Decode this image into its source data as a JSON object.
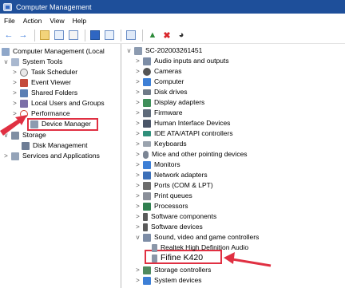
{
  "window": {
    "title": "Computer Management"
  },
  "menu": [
    "File",
    "Action",
    "View",
    "Help"
  ],
  "toolbar": {
    "icons": [
      "back-arrow-icon",
      "forward-arrow-icon",
      "up-folder-icon",
      "properties-icon",
      "console-icon",
      "help-icon",
      "show-hide-icon",
      "scan-hardware-icon",
      "update-driver-icon",
      "uninstall-icon",
      "download-icon"
    ]
  },
  "left_tree": [
    {
      "label": "Computer Management (Local",
      "toggle": "",
      "level": 0
    },
    {
      "label": "System Tools",
      "toggle": "v",
      "level": 1
    },
    {
      "label": "Task Scheduler",
      "toggle": ">",
      "level": 2
    },
    {
      "label": "Event Viewer",
      "toggle": ">",
      "level": 2
    },
    {
      "label": "Shared Folders",
      "toggle": ">",
      "level": 2
    },
    {
      "label": "Local Users and Groups",
      "toggle": ">",
      "level": 2
    },
    {
      "label": "Performance",
      "toggle": ">",
      "level": 2
    },
    {
      "label": "Device Manager",
      "toggle": "",
      "level": 2
    },
    {
      "label": "Storage",
      "toggle": "v",
      "level": 1
    },
    {
      "label": "Disk Management",
      "toggle": "",
      "level": 2
    },
    {
      "label": "Services and Applications",
      "toggle": ">",
      "level": 1
    }
  ],
  "right_tree": {
    "root": "SC-202003261451",
    "categories": [
      "Audio inputs and outputs",
      "Cameras",
      "Computer",
      "Disk drives",
      "Display adapters",
      "Firmware",
      "Human Interface Devices",
      "IDE ATA/ATAPI controllers",
      "Keyboards",
      "Mice and other pointing devices",
      "Monitors",
      "Network adapters",
      "Ports (COM & LPT)",
      "Print queues",
      "Processors",
      "Software components",
      "Software devices"
    ],
    "expanded_category": "Sound, video and game controllers",
    "children": [
      "Realtek High Definition Audio",
      "Fifine K420"
    ],
    "after": [
      "Storage controllers",
      "System devices"
    ]
  },
  "colors": {
    "highlight": "#e03042",
    "titlebar": "#1e4f9a"
  }
}
